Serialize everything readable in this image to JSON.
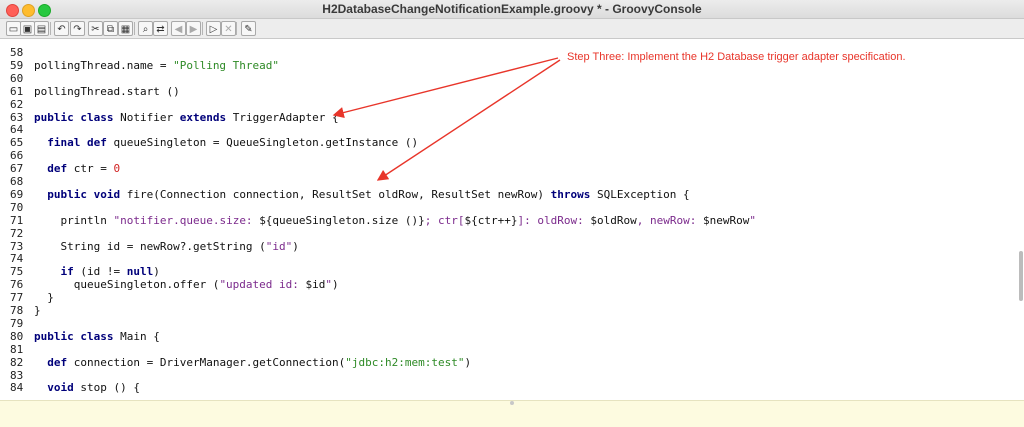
{
  "window": {
    "title": "H2DatabaseChangeNotificationExample.groovy * - GroovyConsole"
  },
  "toolbar": {
    "buttons": [
      {
        "name": "new-file-icon",
        "glyph": "▭"
      },
      {
        "name": "open-file-icon",
        "glyph": "▣"
      },
      {
        "name": "save-file-icon",
        "glyph": "▤"
      },
      {
        "name": "undo-icon",
        "glyph": "↶"
      },
      {
        "name": "redo-icon",
        "glyph": "↷"
      },
      {
        "name": "cut-icon",
        "glyph": "✂"
      },
      {
        "name": "copy-icon",
        "glyph": "⧉"
      },
      {
        "name": "paste-icon",
        "glyph": "▦"
      },
      {
        "name": "find-icon",
        "glyph": "⌕"
      },
      {
        "name": "replace-icon",
        "glyph": "⇄"
      },
      {
        "name": "history-previous-icon",
        "glyph": "◀"
      },
      {
        "name": "history-next-icon",
        "glyph": "▶"
      },
      {
        "name": "run-script-icon",
        "glyph": "▷"
      },
      {
        "name": "interrupt-script-icon",
        "glyph": "✕"
      },
      {
        "name": "clear-output-icon",
        "glyph": "✎"
      }
    ]
  },
  "annotation": {
    "text": "Step Three: Implement the H2 Database trigger adapter specification."
  },
  "code_lines": [
    {
      "n": "58",
      "segs": []
    },
    {
      "n": "59",
      "segs": [
        {
          "t": "pollingThread.name = "
        },
        {
          "t": "\"Polling Thread\"",
          "c": "str"
        }
      ]
    },
    {
      "n": "60",
      "segs": []
    },
    {
      "n": "61",
      "segs": [
        {
          "t": "pollingThread.start ()"
        }
      ]
    },
    {
      "n": "62",
      "segs": []
    },
    {
      "n": "63",
      "segs": [
        {
          "t": "public class",
          "c": "kw"
        },
        {
          "t": " Notifier "
        },
        {
          "t": "extends",
          "c": "kw"
        },
        {
          "t": " TriggerAdapter {"
        }
      ]
    },
    {
      "n": "64",
      "segs": []
    },
    {
      "n": "65",
      "segs": [
        {
          "t": "  "
        },
        {
          "t": "final def",
          "c": "kw"
        },
        {
          "t": " queueSingleton = QueueSingleton.getInstance ()"
        }
      ]
    },
    {
      "n": "66",
      "segs": []
    },
    {
      "n": "67",
      "segs": [
        {
          "t": "  "
        },
        {
          "t": "def",
          "c": "kw"
        },
        {
          "t": " ctr = "
        },
        {
          "t": "0",
          "c": "num"
        }
      ]
    },
    {
      "n": "68",
      "segs": []
    },
    {
      "n": "69",
      "segs": [
        {
          "t": "  "
        },
        {
          "t": "public void",
          "c": "kw"
        },
        {
          "t": " fire(Connection connection, ResultSet oldRow, ResultSet newRow) "
        },
        {
          "t": "throws",
          "c": "kw"
        },
        {
          "t": " SQLException {"
        }
      ]
    },
    {
      "n": "70",
      "segs": []
    },
    {
      "n": "71",
      "segs": [
        {
          "t": "    println "
        },
        {
          "t": "\"notifier.queue.size: ",
          "c": "gs"
        },
        {
          "t": "${queueSingleton.size ()}"
        },
        {
          "t": "; ctr[",
          "c": "gs"
        },
        {
          "t": "${ctr++}"
        },
        {
          "t": "]: oldRow: ",
          "c": "gs"
        },
        {
          "t": "$oldRow"
        },
        {
          "t": ", newRow: ",
          "c": "gs"
        },
        {
          "t": "$newRow"
        },
        {
          "t": "\"",
          "c": "gs"
        }
      ]
    },
    {
      "n": "72",
      "segs": []
    },
    {
      "n": "73",
      "segs": [
        {
          "t": "    String id = newRow?.getString ("
        },
        {
          "t": "\"id\"",
          "c": "gs"
        },
        {
          "t": ")"
        }
      ]
    },
    {
      "n": "74",
      "segs": []
    },
    {
      "n": "75",
      "segs": [
        {
          "t": "    "
        },
        {
          "t": "if",
          "c": "kw"
        },
        {
          "t": " (id != "
        },
        {
          "t": "null",
          "c": "kw"
        },
        {
          "t": ")"
        }
      ]
    },
    {
      "n": "76",
      "segs": [
        {
          "t": "      queueSingleton.offer ("
        },
        {
          "t": "\"updated id: ",
          "c": "gs"
        },
        {
          "t": "$id"
        },
        {
          "t": "\"",
          "c": "gs"
        },
        {
          "t": ")"
        }
      ]
    },
    {
      "n": "77",
      "segs": [
        {
          "t": "  }"
        }
      ]
    },
    {
      "n": "78",
      "segs": [
        {
          "t": "}"
        }
      ]
    },
    {
      "n": "79",
      "segs": []
    },
    {
      "n": "80",
      "segs": [
        {
          "t": "public class",
          "c": "kw"
        },
        {
          "t": " Main {"
        }
      ]
    },
    {
      "n": "81",
      "segs": []
    },
    {
      "n": "82",
      "segs": [
        {
          "t": "  "
        },
        {
          "t": "def",
          "c": "kw"
        },
        {
          "t": " connection = DriverManager.getConnection("
        },
        {
          "t": "\"jdbc:h2:mem:test\"",
          "c": "str"
        },
        {
          "t": ")"
        }
      ]
    },
    {
      "n": "83",
      "segs": []
    },
    {
      "n": "84",
      "segs": [
        {
          "t": "  "
        },
        {
          "t": "void",
          "c": "kw"
        },
        {
          "t": " stop () {"
        }
      ]
    }
  ],
  "colors": {
    "keyword": "#00007a",
    "string": "#2e8a26",
    "gstring": "#7b2a8c",
    "number": "#d12222",
    "annotation": "#e8352a"
  }
}
